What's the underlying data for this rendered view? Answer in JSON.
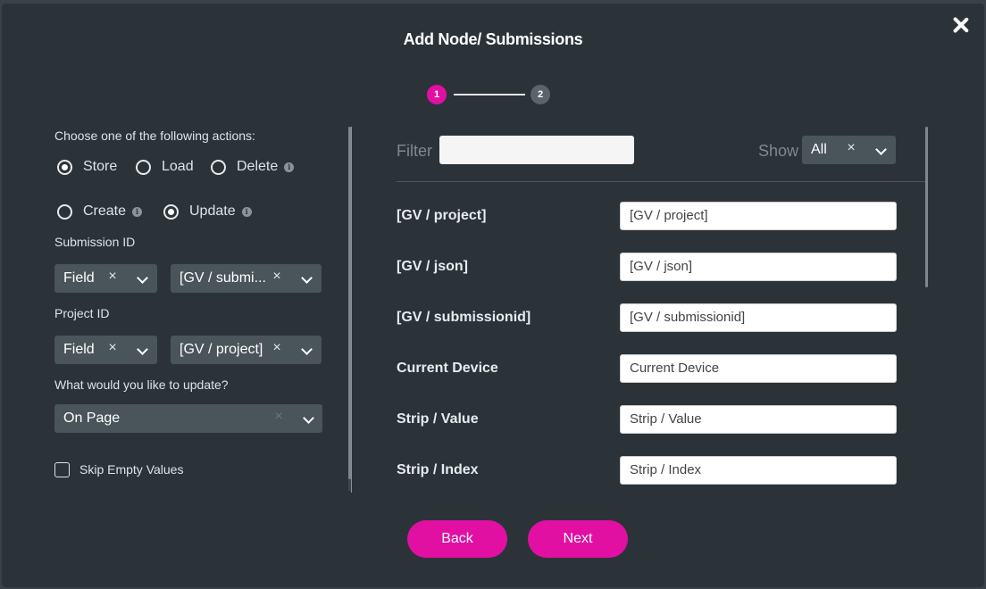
{
  "dialog": {
    "title": "Add Node/ Submissions"
  },
  "steps": [
    "1",
    "2"
  ],
  "actions": {
    "prompt": "Choose one of the following actions:",
    "options": [
      {
        "label": "Store",
        "selected": true,
        "info": false
      },
      {
        "label": "Load",
        "selected": false,
        "info": false
      },
      {
        "label": "Delete",
        "selected": false,
        "info": true
      },
      {
        "label": "Create",
        "selected": false,
        "info": true
      },
      {
        "label": "Update",
        "selected": true,
        "info": true
      }
    ]
  },
  "submission_id": {
    "label": "Submission ID",
    "type_value": "Field",
    "value": "[GV / submissionid]",
    "value_display": "[GV / submi..."
  },
  "project_id": {
    "label": "Project ID",
    "type_value": "Field",
    "value": "[GV / project]"
  },
  "update": {
    "label": "What would you like to update?",
    "value": "On Page"
  },
  "skip_empty": {
    "label": "Skip Empty Values",
    "checked": false
  },
  "filter": {
    "label": "Filter",
    "value": ""
  },
  "show": {
    "label": "Show",
    "value": "All"
  },
  "fields": [
    {
      "label": "[GV / project]",
      "value": "[GV / project]"
    },
    {
      "label": "[GV / json]",
      "value": "[GV / json]"
    },
    {
      "label": "[GV / submissionid]",
      "value": "[GV / submissionid]"
    },
    {
      "label": "Current Device",
      "value": "Current Device"
    },
    {
      "label": "Strip / Value",
      "value": "Strip / Value"
    },
    {
      "label": "Strip / Index",
      "value": "Strip / Index"
    }
  ],
  "buttons": {
    "back": "Back",
    "next": "Next"
  },
  "icons": {
    "close": "close-icon",
    "info": "info-icon",
    "clear": "clear-x-icon",
    "dropdown": "chevron-down-icon"
  },
  "colors": {
    "accent": "#e20fa3",
    "modal_bg": "#2b3339",
    "select_bg": "#4a545b"
  }
}
